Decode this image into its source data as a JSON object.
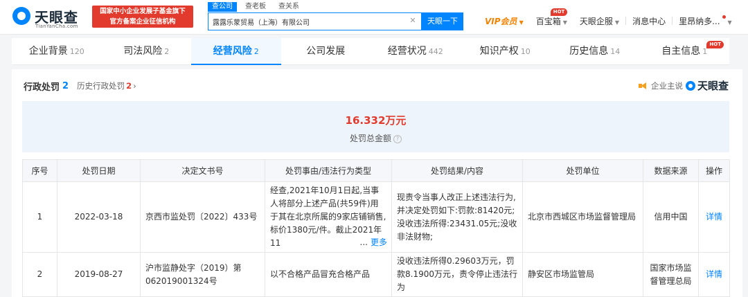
{
  "header": {
    "logo_name": "天眼查",
    "logo_domain": "TianYanCha.com",
    "gov_badge_line1": "国家中小企业发展子基金旗下",
    "gov_badge_line2": "官方备案企业征信机构",
    "search_tabs": [
      "查公司",
      "查老板",
      "查关系"
    ],
    "search_value": "露露乐蒙贸易（上海）有限公司",
    "search_button": "天眼一下",
    "nav": {
      "vip": "VIP会员",
      "treasure": "百宝箱",
      "treasure_badge": "HOT",
      "enterprise": "天眼企服",
      "messages": "消息中心",
      "user": "里昂纳多..."
    }
  },
  "tabs": [
    {
      "label": "企业背景",
      "count": "120"
    },
    {
      "label": "司法风险",
      "count": "2"
    },
    {
      "label": "经营风险",
      "count": "2"
    },
    {
      "label": "公司发展",
      "count": ""
    },
    {
      "label": "经营状况",
      "count": "442"
    },
    {
      "label": "知识产权",
      "count": "10"
    },
    {
      "label": "历史信息",
      "count": "14"
    },
    {
      "label": "自主信息",
      "count": "1",
      "badge": "HOT"
    }
  ],
  "section": {
    "title": "行政处罚",
    "count": "2",
    "history_label": "历史行政处罚",
    "history_count": "2",
    "claim_label": "企业主说",
    "brand": "天眼查"
  },
  "summary": {
    "amount": "16.332万元",
    "label": "处罚总金额"
  },
  "table": {
    "columns": [
      "序号",
      "处罚日期",
      "决定文书号",
      "处罚事由/违法行为类型",
      "处罚结果/内容",
      "处罚单位",
      "数据来源",
      "操作"
    ],
    "more_label": "更多",
    "rows": [
      {
        "index": "1",
        "date": "2022-03-18",
        "doc_no": "京西市监处罚〔2022〕433号",
        "reason": "经查,2021年10月1日起,当事人将部分上述产品(共59件)用于其在北京所属的9家店铺销售,标价1380元/件。截止2021年11",
        "result": "现责令当事人改正上述违法行为,并决定处罚如下:罚款:81420元;没收违法所得:23431.05元;没收非法财物;",
        "unit": "北京市西城区市场监督管理局",
        "source": "信用中国",
        "action": "详情"
      },
      {
        "index": "2",
        "date": "2019-08-27",
        "doc_no": "沪市监静处字（2019）第062019001324号",
        "reason": "以不合格产品冒充合格产品",
        "result": "没收违法所得0.29603万元，罚款8.1900万元，责令停止违法行为",
        "unit": "静安区市场监管局",
        "source": "国家市场监督管理总局",
        "action": "详情"
      }
    ]
  }
}
